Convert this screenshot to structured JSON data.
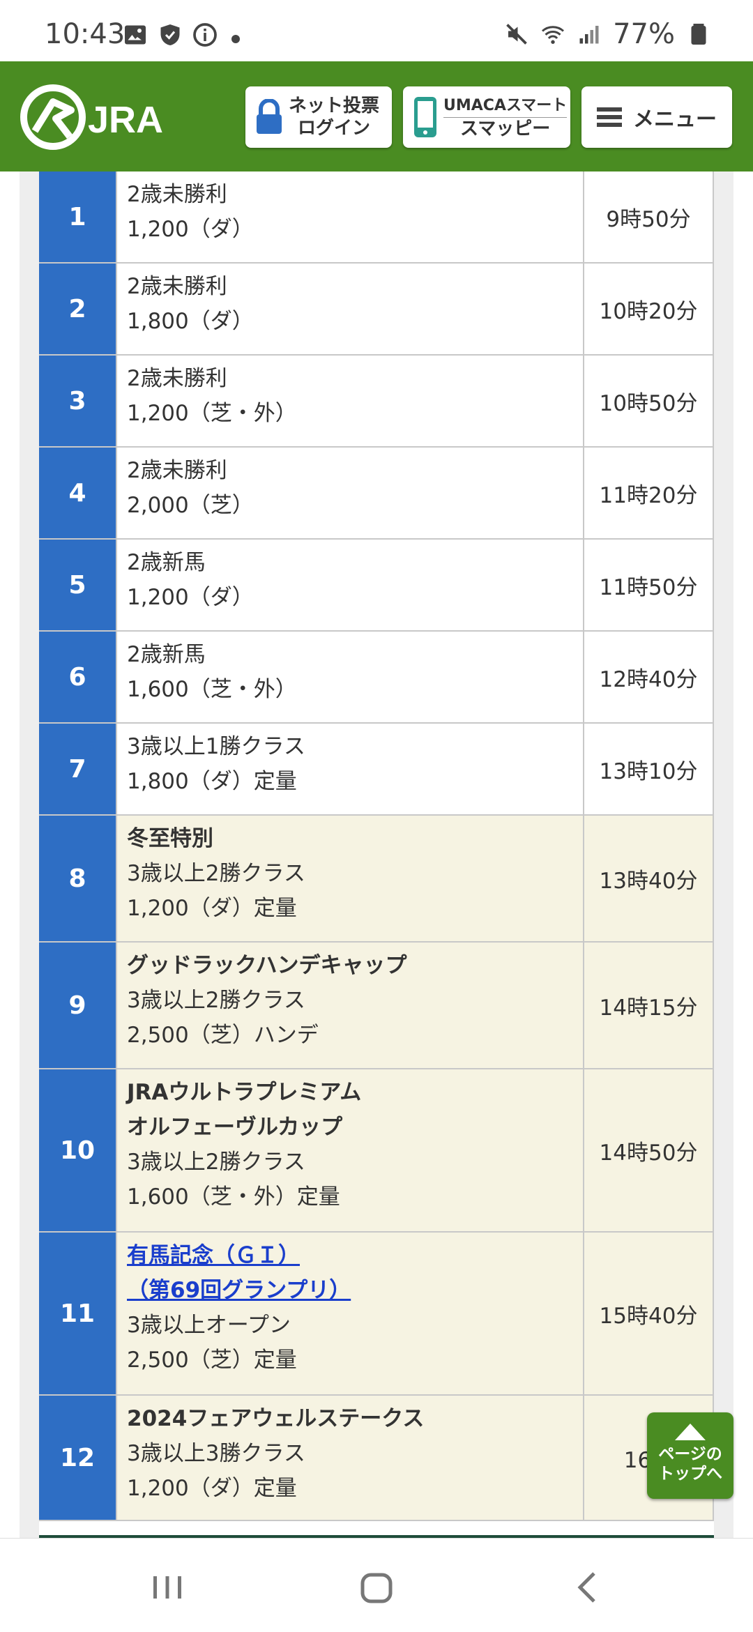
{
  "status_bar": {
    "time": "10:43",
    "battery": "77%",
    "icons": [
      "image-icon",
      "shield-icon",
      "info-icon",
      "mute-icon",
      "wifi-icon",
      "signal-icon",
      "battery-icon"
    ]
  },
  "header": {
    "logo_text": "JRA",
    "login_line1": "ネット投票",
    "login_line2": "ログイン",
    "umaca_line1": "UMACAスマート",
    "umaca_line2": "スマッピー",
    "menu_label": "メニュー",
    "colors": {
      "header_bg": "#4a8c22",
      "num_cell": "#2e6ec4",
      "special_row": "#f6f3e2",
      "link": "#1a3ecc"
    }
  },
  "races": [
    {
      "num": "1",
      "lines": [
        "2歳未勝利",
        "1,200（ダ）"
      ],
      "time": "9時50分"
    },
    {
      "num": "2",
      "lines": [
        "2歳未勝利",
        "1,800（ダ）"
      ],
      "time": "10時20分"
    },
    {
      "num": "3",
      "lines": [
        "2歳未勝利",
        "1,200（芝・外）"
      ],
      "time": "10時50分"
    },
    {
      "num": "4",
      "lines": [
        "2歳未勝利",
        "2,000（芝）"
      ],
      "time": "11時20分"
    },
    {
      "num": "5",
      "lines": [
        "2歳新馬",
        "1,200（ダ）"
      ],
      "time": "11時50分"
    },
    {
      "num": "6",
      "lines": [
        "2歳新馬",
        "1,600（芝・外）"
      ],
      "time": "12時40分"
    },
    {
      "num": "7",
      "lines": [
        "3歳以上1勝クラス",
        "1,800（ダ）定量"
      ],
      "time": "13時10分"
    },
    {
      "num": "8",
      "name": [
        "冬至特別"
      ],
      "lines": [
        "3歳以上2勝クラス",
        "1,200（ダ）定量"
      ],
      "time": "13時40分"
    },
    {
      "num": "9",
      "name": [
        "グッドラックハンデキャップ"
      ],
      "lines": [
        "3歳以上2勝クラス",
        "2,500（芝）ハンデ"
      ],
      "time": "14時15分"
    },
    {
      "num": "10",
      "name": [
        "JRAウルトラプレミアム",
        "オルフェーヴルカップ"
      ],
      "lines": [
        "3歳以上2勝クラス",
        "1,600（芝・外）定量"
      ],
      "time": "14時50分"
    },
    {
      "num": "11",
      "link": [
        "有馬記念（ＧＩ）",
        "（第69回グランプリ）"
      ],
      "lines": [
        "3歳以上オープン",
        "2,500（芝）定量"
      ],
      "time": "15時40分"
    },
    {
      "num": "12",
      "name": [
        "2024フェアウェルステークス"
      ],
      "lines": [
        "3歳以上3勝クラス",
        "1,200（ダ）定量"
      ],
      "time": "16時"
    }
  ],
  "page_top": {
    "line1": "ページの",
    "line2": "トップへ"
  }
}
